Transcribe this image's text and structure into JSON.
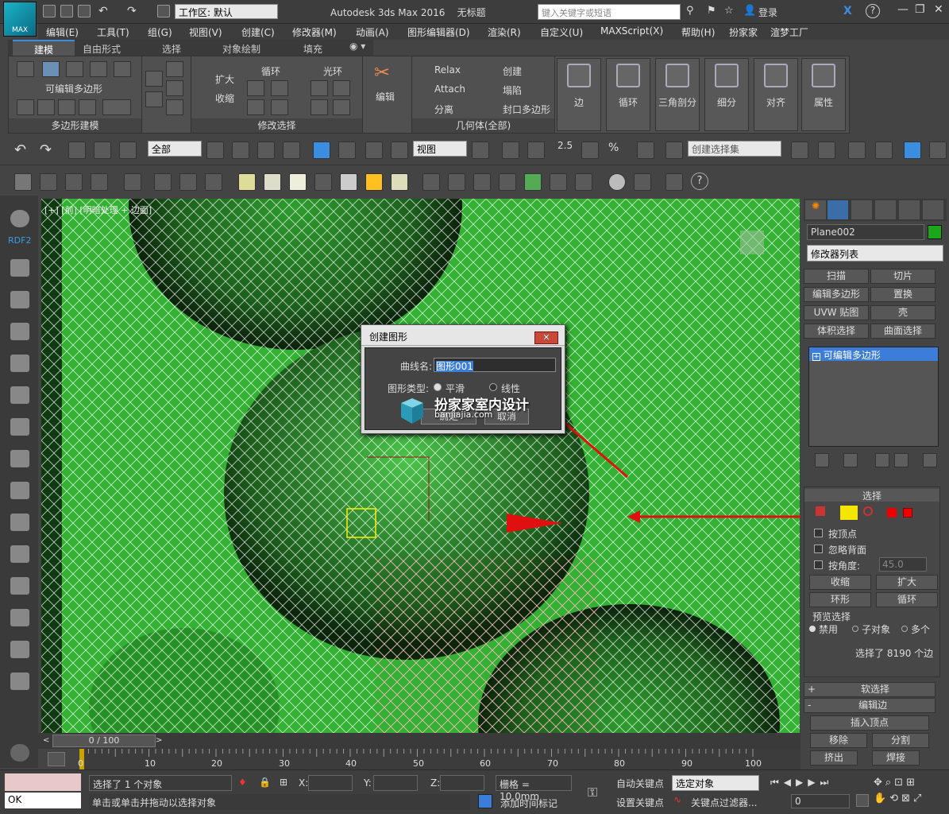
{
  "app": {
    "logo_text": "MAX",
    "workspace": "工作区: 默认",
    "title": "Autodesk 3ds Max 2016",
    "doc_title": "无标题",
    "search_placeholder": "键入关键字或短语",
    "login": "登录"
  },
  "menu": [
    "编辑(E)",
    "工具(T)",
    "组(G)",
    "视图(V)",
    "创建(C)",
    "修改器(M)",
    "动画(A)",
    "图形编辑器(D)",
    "渲染(R)",
    "自定义(U)",
    "MAXScript(X)",
    "帮助(H)",
    "扮家家",
    "渲梦工厂"
  ],
  "ribbon_tabs": [
    "建模",
    "自由形式",
    "选择",
    "对象绘制",
    "填充"
  ],
  "ribbon": {
    "poly_title": "可编辑多边形",
    "poly_panel": "多边形建模",
    "grow": "扩大",
    "shrink": "收缩",
    "loop": "循环",
    "ring": "光环",
    "modsel_panel": "修改选择",
    "edit": "编辑",
    "relax": "Relax",
    "create": "创建",
    "attach": "Attach",
    "collapse": "塌陷",
    "detach": "分离",
    "cap": "封口多边形",
    "geo_panel": "几何体(全部)",
    "edge": "边",
    "loop_big": "循环",
    "tri": "三角剖分",
    "subdiv": "细分",
    "align": "对齐",
    "props": "属性"
  },
  "toolbar1": {
    "filter": "全部",
    "view": "视图",
    "snap_angle": "2.5",
    "percent": "%",
    "named_sel": "创建选择集"
  },
  "left": {
    "rdf": "RDF2"
  },
  "viewport": {
    "label": "[+] [前] [明暗处理 + 边面]"
  },
  "dialog": {
    "title": "创建图形",
    "close": "✕",
    "name_label": "曲线名:",
    "name_value": "图形001",
    "type_label": "图形类型:",
    "smooth": "平滑",
    "linear": "线性",
    "ok": "确定",
    "cancel": "取消"
  },
  "watermark": {
    "line1": "扮家家室内设计",
    "line2": "banjiajia.com"
  },
  "right": {
    "obj_name": "Plane002",
    "mod_list": "修改器列表",
    "mods": [
      "扫描",
      "切片",
      "编辑多边形",
      "置换",
      "UVW 贴图",
      "壳",
      "体积选择",
      "曲面选择"
    ],
    "stack_item": "可编辑多边形",
    "sel_title": "选择",
    "by_vertex": "按顶点",
    "ignore_back": "忽略背面",
    "by_angle": "按角度:",
    "angle_val": "45.0",
    "shrink": "收缩",
    "grow": "扩大",
    "ring": "环形",
    "loop": "循环",
    "preview_title": "预览选择",
    "disable": "禁用",
    "sub": "子对象",
    "multi": "多个",
    "sel_count": "选择了 8190 个边",
    "soft_sel": "软选择",
    "edit_edges": "编辑边",
    "insert_vertex": "插入顶点",
    "remove": "移除",
    "split": "分割",
    "extrude": "挤出",
    "weld": "焊接"
  },
  "timeline": {
    "pos": "0 / 100",
    "ticks": [
      "0",
      "10",
      "20",
      "30",
      "40",
      "50",
      "60",
      "70",
      "80",
      "90",
      "100"
    ]
  },
  "status": {
    "ok": "OK",
    "selected": "选择了 1 个对象",
    "hint": "单击或单击并拖动以选择对象",
    "x": "X:",
    "y": "Y:",
    "z": "Z:",
    "grid": "栅格 = 10.0mm",
    "addtime": "添加时间标记",
    "autokey": "自动关键点",
    "setkey": "设置关键点",
    "sel_obj": "选定对象",
    "keyfilter": "关键点过滤器...",
    "frame": "0"
  },
  "colors": {
    "viewport": "#2fa52f",
    "highlight": "#3b8de0",
    "selected_yellow": "#f3e600",
    "arrow": "#e01010"
  }
}
